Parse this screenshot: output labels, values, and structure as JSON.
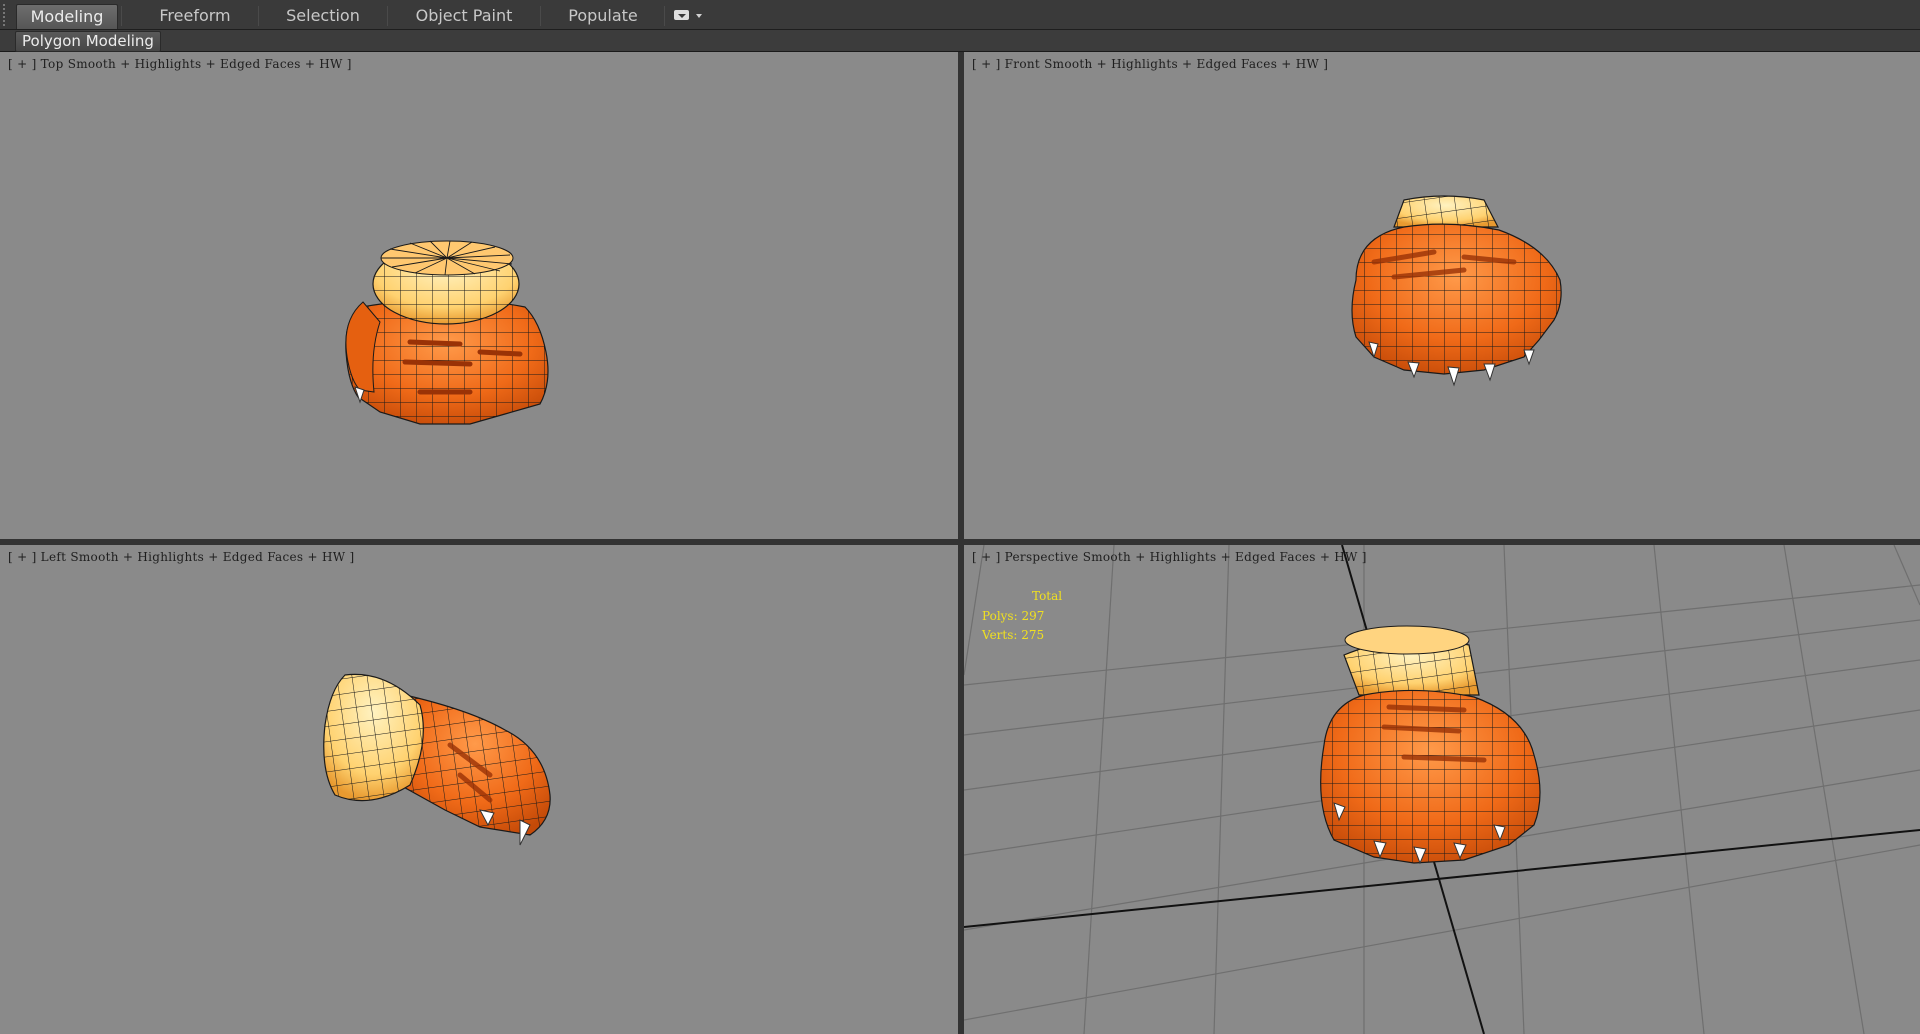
{
  "ribbon": {
    "tabs": [
      {
        "label": "Modeling",
        "active": true
      },
      {
        "label": "Freeform",
        "active": false
      },
      {
        "label": "Selection",
        "active": false
      },
      {
        "label": "Object Paint",
        "active": false
      },
      {
        "label": "Populate",
        "active": false
      }
    ],
    "panel_label": "Polygon Modeling"
  },
  "viewports": {
    "top": {
      "plus": "[ + ]",
      "name": "Top",
      "shading": "Smooth + Highlights + Edged Faces + HW ]"
    },
    "front": {
      "plus": "[ + ]",
      "name": "Front",
      "shading": "Smooth + Highlights + Edged Faces + HW ]"
    },
    "left": {
      "plus": "[ + ]",
      "name": "Left",
      "shading": "Smooth + Highlights + Edged Faces + HW ]"
    },
    "perspective": {
      "plus": "[ + ]",
      "name": "Perspective",
      "shading": "Smooth + Highlights + Edged Faces + HW ]",
      "stats": {
        "header": "Total",
        "polys": "Polys: 297",
        "verts": "Verts: 275"
      }
    }
  },
  "colors": {
    "viewport_bg": "#8a8a8a",
    "model_orange": "#f06a18",
    "cuff_yellow": "#ffd97a",
    "wire": "#1a1a1a",
    "stats_text": "#f0e020"
  },
  "icons": {
    "ribbon_toggle": "ribbon-minimize-icon"
  }
}
